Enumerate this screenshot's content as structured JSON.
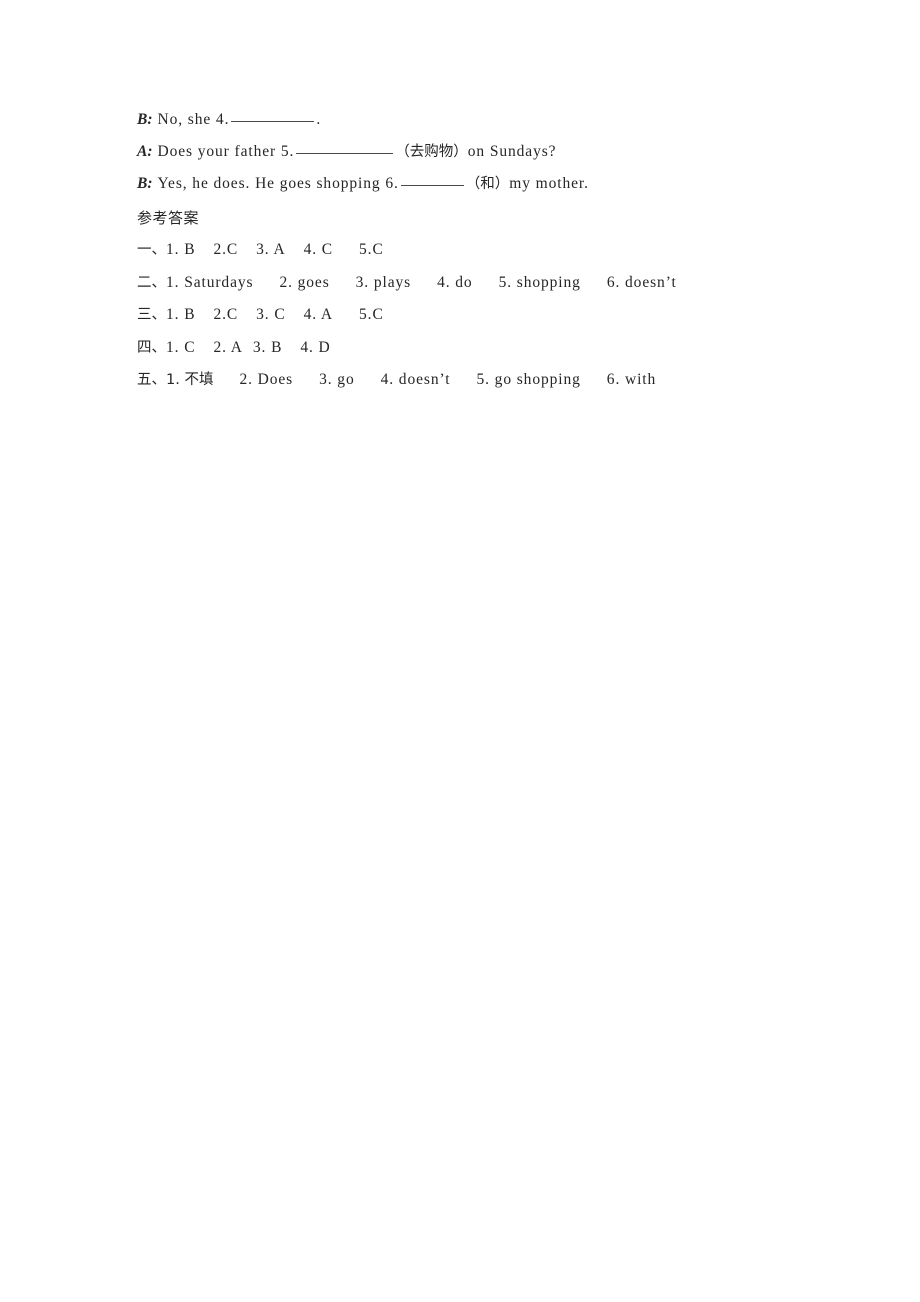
{
  "document": {
    "background_color": "#ffffff",
    "text_color": "#262626",
    "dialogue": [
      {
        "speaker": "B:",
        "segments_1": "No, she 4.",
        "blank": "underline-blank",
        "segments_2": "."
      },
      {
        "speaker": "A:",
        "segments_1": "Does your father 5.",
        "blank": "underline-blank",
        "hint": "（去购物）",
        "segments_2": "on Sundays?"
      },
      {
        "speaker": "B:",
        "segments_1": "Yes, he does. He goes shopping 6.",
        "blank": "underline-blank",
        "hint": "（和）",
        "segments_2": "my mother."
      }
    ],
    "answer_key": {
      "heading": "参考答案",
      "sections": [
        {
          "label": "一、",
          "items": [
            "1. B",
            "2.C",
            "3. A",
            "4. C",
            "5.C"
          ]
        },
        {
          "label": "二、",
          "items": [
            "1. Saturdays",
            "2. goes",
            "3. plays",
            "4. do",
            "5. shopping",
            "6. doesn’t"
          ]
        },
        {
          "label": "三、",
          "items": [
            "1. B",
            "2.C",
            "3. C",
            "4. A",
            "5.C"
          ]
        },
        {
          "label": "四、",
          "items": [
            "1. C",
            "2. A",
            "3. B",
            "4. D"
          ]
        },
        {
          "label": "五、",
          "items": [
            "1. 不填",
            "2. Does",
            "3. go",
            "4. doesn’t",
            "5. go shopping",
            "6. with"
          ]
        }
      ]
    }
  }
}
